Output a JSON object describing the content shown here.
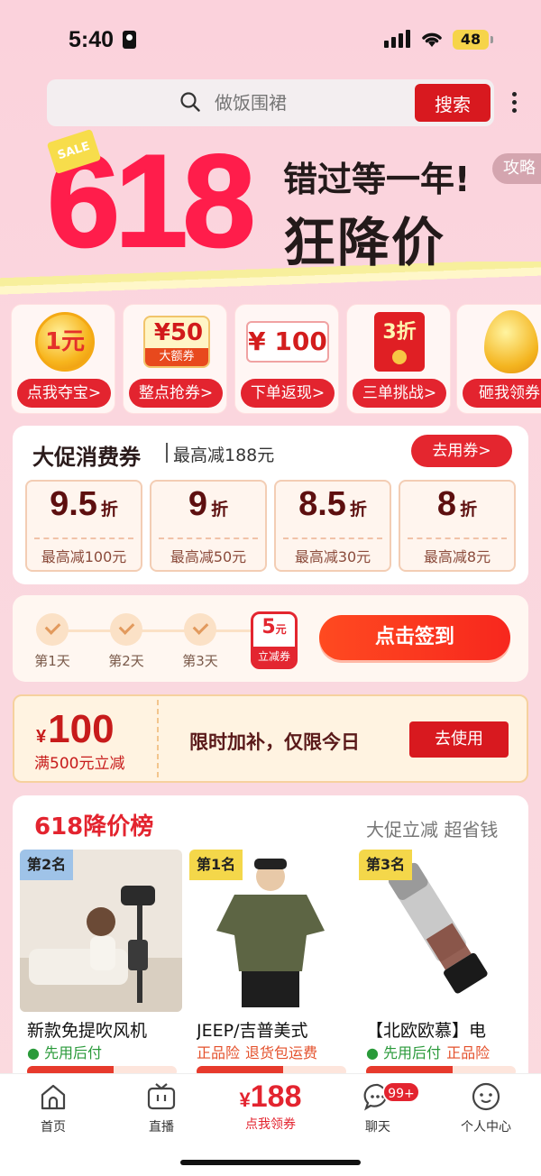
{
  "status": {
    "time": "5:40",
    "battery": "48"
  },
  "search": {
    "placeholder": "做饭围裙",
    "button": "搜索"
  },
  "banner": {
    "big": "618",
    "sale": "SALE",
    "line1": "错过等一年!",
    "line2": "狂降价",
    "strategy": "攻略"
  },
  "promo_cards": [
    {
      "label": "点我夺宝>",
      "icon": "1元"
    },
    {
      "label": "整点抢券>",
      "icon": "¥50",
      "sub": "大额券"
    },
    {
      "label": "下单返现>",
      "icon": "¥ 100"
    },
    {
      "label": "三单挑战>",
      "icon": "3折"
    },
    {
      "label": "砸我领券",
      "icon": "golden-egg-icon"
    }
  ],
  "coupons": {
    "title": "大促消费券",
    "subtitle": "最高减188元",
    "use_button": "去用券>",
    "items": [
      {
        "discount": "9.5",
        "unit": "折",
        "max": "最高减100元"
      },
      {
        "discount": "9",
        "unit": "折",
        "max": "最高减50元"
      },
      {
        "discount": "8.5",
        "unit": "折",
        "max": "最高减30元"
      },
      {
        "discount": "8",
        "unit": "折",
        "max": "最高减8元"
      }
    ]
  },
  "signin": {
    "days": [
      "第1天",
      "第2天",
      "第3天"
    ],
    "reward_value": "5",
    "reward_unit": "元",
    "reward_label": "立减券",
    "button": "点击签到"
  },
  "voucher": {
    "symbol": "¥",
    "amount": "100",
    "condition": "满500元立减",
    "desc": "限时加补，仅限今日",
    "button": "去使用"
  },
  "ranking": {
    "title": "618降价榜",
    "subtitle": "大促立减 超省钱",
    "products": [
      {
        "rank": "第2名",
        "name": "新款免提吹风机",
        "tag1": "先用后付",
        "tag2": ""
      },
      {
        "rank": "第1名",
        "name": "JEEP/吉普美式",
        "tag1": "正品险",
        "tag2": "退货包运费"
      },
      {
        "rank": "第3名",
        "name": "【北欧欧慕】电",
        "tag1": "先用后付",
        "tag2": "正品险"
      }
    ]
  },
  "tabbar": {
    "items": [
      "首页",
      "直播",
      "聊天",
      "个人中心"
    ],
    "center_symbol": "¥",
    "center_amount": "188",
    "center_label": "点我领券",
    "chat_badge": "99+"
  }
}
